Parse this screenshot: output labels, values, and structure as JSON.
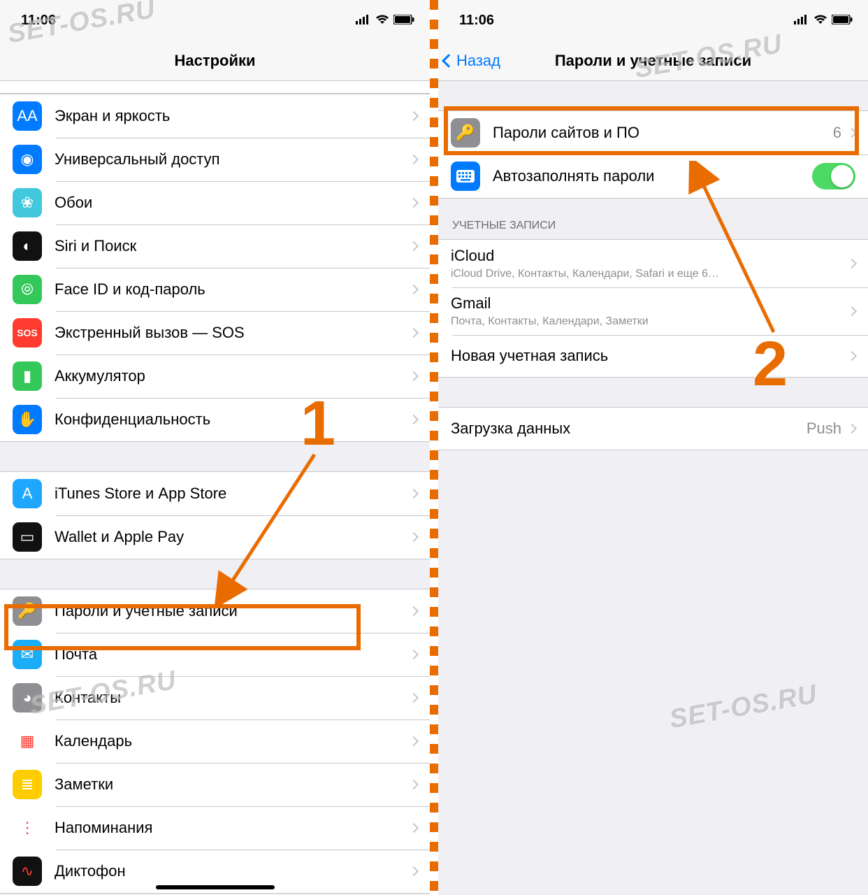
{
  "status": {
    "time": "11:06"
  },
  "watermark": "SET-OS.RU",
  "annotation": {
    "step1": "1",
    "step2": "2"
  },
  "left": {
    "title": "Настройки",
    "rows": [
      {
        "id": "display",
        "label": "Экран и яркость",
        "icon": "AA",
        "bg": "#007aff"
      },
      {
        "id": "accessibility",
        "label": "Универсальный доступ",
        "icon": "◉",
        "bg": "#007aff"
      },
      {
        "id": "wallpaper",
        "label": "Обои",
        "icon": "❀",
        "bg": "#42c8dc"
      },
      {
        "id": "siri",
        "label": "Siri и Поиск",
        "icon": "◐",
        "bg": "#111"
      },
      {
        "id": "faceid",
        "label": "Face ID и код-пароль",
        "icon": "⦾",
        "bg": "#34c759"
      },
      {
        "id": "sos",
        "label": "Экстренный вызов — SOS",
        "icon": "SOS",
        "bg": "#ff3b30",
        "small": true
      },
      {
        "id": "battery",
        "label": "Аккумулятор",
        "icon": "▮",
        "bg": "#34c759"
      },
      {
        "id": "privacy",
        "label": "Конфиденциальность",
        "icon": "✋",
        "bg": "#007aff"
      }
    ],
    "rows2": [
      {
        "id": "itunes",
        "label": "iTunes Store и App Store",
        "icon": "A",
        "bg": "#1ea7fd"
      },
      {
        "id": "wallet",
        "label": "Wallet и Apple Pay",
        "icon": "▭",
        "bg": "#111"
      }
    ],
    "rows3": [
      {
        "id": "passwords",
        "label": "Пароли и учетные записи",
        "icon": "🔑",
        "bg": "#8e8e93"
      },
      {
        "id": "mail",
        "label": "Почта",
        "icon": "✉",
        "bg": "#1badf8"
      },
      {
        "id": "contacts",
        "label": "Контакты",
        "icon": "◕",
        "bg": "#8e8e93"
      },
      {
        "id": "calendar",
        "label": "Календарь",
        "icon": "▦",
        "bg": "#fff",
        "fg": "#ff3b30"
      },
      {
        "id": "notes",
        "label": "Заметки",
        "icon": "≣",
        "bg": "#ffcc00"
      },
      {
        "id": "reminders",
        "label": "Напоминания",
        "icon": "⋮",
        "bg": "#fff",
        "fg": "#ff3b30"
      },
      {
        "id": "voice",
        "label": "Диктофон",
        "icon": "∿",
        "bg": "#111",
        "fg": "#ff3b30"
      }
    ]
  },
  "right": {
    "back": "Назад",
    "title": "Пароли и учетные записи",
    "passwords_row": {
      "label": "Пароли сайтов и ПО",
      "count": "6"
    },
    "autofill_row": {
      "label": "Автозаполнять пароли"
    },
    "accounts_header": "Учетные записи",
    "accounts": [
      {
        "id": "icloud",
        "label": "iCloud",
        "sub": "iCloud Drive, Контакты, Календари, Safari и еще 6…"
      },
      {
        "id": "gmail",
        "label": "Gmail",
        "sub": "Почта, Контакты, Календари, Заметки"
      },
      {
        "id": "add",
        "label": "Новая учетная запись"
      }
    ],
    "fetch_row": {
      "label": "Загрузка данных",
      "value": "Push"
    }
  }
}
